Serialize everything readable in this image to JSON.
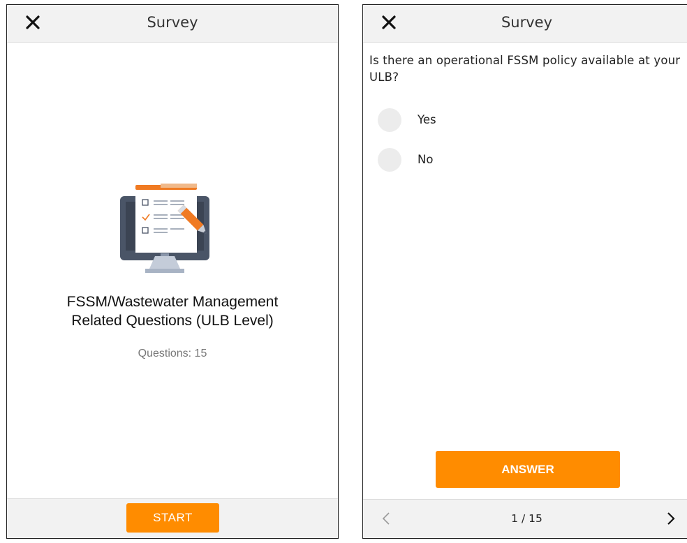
{
  "left_screen": {
    "header": {
      "title": "Survey",
      "close_icon": "close-icon"
    },
    "survey": {
      "title_line1": "FSSM/Wastewater Management",
      "title_line2": "Related Questions (ULB Level)",
      "question_count": "Questions: 15",
      "illustration": "computer-checklist-icon"
    },
    "start_label": "START"
  },
  "right_screen": {
    "header": {
      "title": "Survey",
      "close_icon": "close-icon"
    },
    "question": "Is there an operational FSSM policy available at your ULB?",
    "options": [
      {
        "label": "Yes",
        "selected": false
      },
      {
        "label": "No",
        "selected": false
      }
    ],
    "answer_label": "ANSWER",
    "pager": {
      "page": "1 / 15",
      "prev_icon": "chevron-left-icon",
      "next_icon": "chevron-right-icon"
    }
  },
  "colors": {
    "accent": "#ff8c00",
    "header_bg": "#f2f2f2",
    "radio_bg": "#ececec",
    "muted_text": "#777777"
  }
}
